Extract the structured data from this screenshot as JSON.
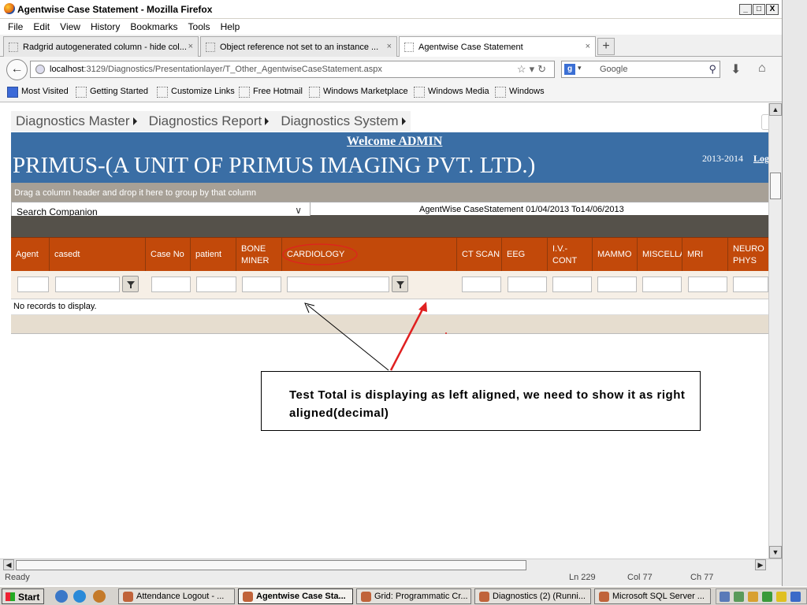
{
  "window": {
    "title": "Agentwise Case Statement - Mozilla Firefox",
    "btn_min": "_",
    "btn_max": "□",
    "btn_close": "X"
  },
  "menu": {
    "file": "File",
    "edit": "Edit",
    "view": "View",
    "history": "History",
    "bookmarks": "Bookmarks",
    "tools": "Tools",
    "help": "Help"
  },
  "tabs": [
    {
      "label": "Radgrid autogenerated column - hide col...",
      "close": "×"
    },
    {
      "label": "Object reference not set to an instance ...",
      "close": "×"
    },
    {
      "label": "Agentwise Case Statement",
      "close": "×"
    }
  ],
  "newtab": "+",
  "nav": {
    "url_host": "localhost",
    "url_path": ":3129/Diagnostics/Presentationlayer/T_Other_AgentwiseCaseStatement.aspx",
    "search_placeholder": "Google",
    "search_engine_letter": "g"
  },
  "bookmarks": [
    "Most Visited",
    "Getting Started",
    "Customize Links",
    "Free Hotmail",
    "Windows Marketplace",
    "Windows Media",
    "Windows"
  ],
  "page": {
    "topnav": [
      "Diagnostics Master",
      "Diagnostics Report",
      "Diagnostics System"
    ],
    "welcome": "Welcome ADMIN",
    "company": "PRIMUS-(A UNIT OF PRIMUS IMAGING PVT. LTD.)",
    "year": "2013-2014",
    "logout": "Log",
    "group_hint": "Drag a column header and drop it here to group by that column",
    "companion": "Search Companion",
    "range": "AgentWise CaseStatement 01/04/2013 To14/06/2013",
    "columns": [
      "Agent",
      "casedt",
      "Case No",
      "patient",
      "BONE MINER",
      "CARDIOLOGY",
      "CT SCAN",
      "EEG",
      "I.V.- CONT",
      "MAMMO",
      "MISCELLA",
      "MRI",
      "NEURO PHYS"
    ],
    "no_records": "No records to display.",
    "annotation": "Test Total is displaying as left aligned, we need to show it as right aligned(decimal)"
  },
  "status": {
    "left": "Ready",
    "ln": "Ln 229",
    "col": "Col 77",
    "ch": "Ch 77"
  },
  "taskbar": {
    "start": "Start",
    "items": [
      "Attendance Logout - ...",
      "Agentwise Case Sta...",
      "Grid: Programmatic Cr...",
      "Diagnostics (2) (Runni...",
      "Microsoft SQL Server ..."
    ]
  },
  "colors": {
    "banner": "#3a6ea5",
    "grid_header": "#c2490a",
    "group_bar": "#a7a096",
    "annotation_arrow": "#e02020"
  }
}
